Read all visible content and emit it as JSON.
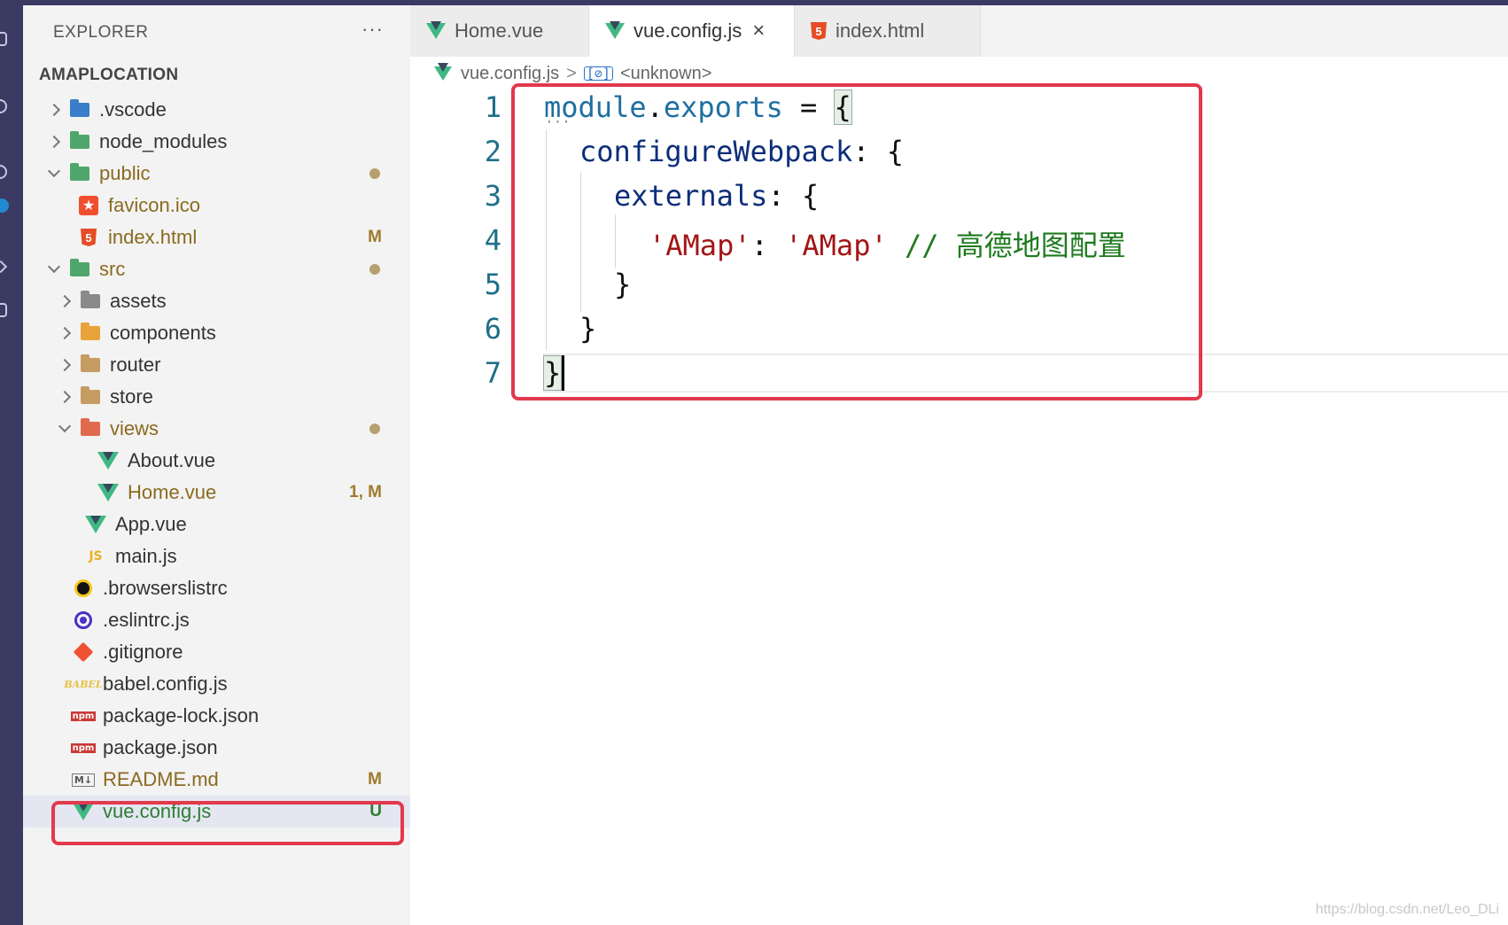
{
  "explorer": {
    "title": "EXPLORER",
    "more": "···",
    "root_label": "AMAPLOCATION",
    "items": [
      {
        "name": ".vscode",
        "icon": "folder-vscode-icon",
        "deco": ""
      },
      {
        "name": "node_modules",
        "icon": "folder-node-icon",
        "deco": ""
      },
      {
        "name": "public",
        "icon": "folder-public-icon",
        "deco": "dot"
      },
      {
        "name": "favicon.ico",
        "icon": "favicon-icon",
        "deco": ""
      },
      {
        "name": "index.html",
        "icon": "html5-icon",
        "deco": "M"
      },
      {
        "name": "src",
        "icon": "folder-src-icon",
        "deco": "dot"
      },
      {
        "name": "assets",
        "icon": "folder-assets-icon",
        "deco": ""
      },
      {
        "name": "components",
        "icon": "folder-components-icon",
        "deco": ""
      },
      {
        "name": "router",
        "icon": "folder-icon",
        "deco": ""
      },
      {
        "name": "store",
        "icon": "folder-icon",
        "deco": ""
      },
      {
        "name": "views",
        "icon": "folder-views-icon",
        "deco": "dot"
      },
      {
        "name": "About.vue",
        "icon": "vue-icon",
        "deco": ""
      },
      {
        "name": "Home.vue",
        "icon": "vue-icon",
        "deco": "1, M"
      },
      {
        "name": "App.vue",
        "icon": "vue-icon",
        "deco": ""
      },
      {
        "name": "main.js",
        "icon": "js-icon",
        "deco": ""
      },
      {
        "name": ".browserslistrc",
        "icon": "browserslist-icon",
        "deco": ""
      },
      {
        "name": ".eslintrc.js",
        "icon": "eslint-icon",
        "deco": ""
      },
      {
        "name": ".gitignore",
        "icon": "git-icon",
        "deco": ""
      },
      {
        "name": "babel.config.js",
        "icon": "babel-icon",
        "deco": ""
      },
      {
        "name": "package-lock.json",
        "icon": "npm-icon",
        "deco": ""
      },
      {
        "name": "package.json",
        "icon": "npm-icon",
        "deco": ""
      },
      {
        "name": "README.md",
        "icon": "markdown-icon",
        "deco": "M"
      },
      {
        "name": "vue.config.js",
        "icon": "vue-config-icon",
        "deco": "U"
      }
    ]
  },
  "icon_text": {
    "html": "5",
    "star": "★",
    "js": "JS",
    "npm": "npm",
    "babel": "BABEL",
    "md": "M↓"
  },
  "tabs": [
    {
      "label": "Home.vue",
      "icon": "vue-icon",
      "active": false
    },
    {
      "label": "vue.config.js",
      "icon": "vue-config-icon",
      "active": true
    },
    {
      "label": "index.html",
      "icon": "html5-icon",
      "active": false
    }
  ],
  "tab_close": "×",
  "breadcrumb": {
    "file": "vue.config.js",
    "separator": ">",
    "symbol_icon": "[⊘]",
    "symbol": "<unknown>"
  },
  "editor": {
    "line_numbers": [
      "1",
      "2",
      "3",
      "4",
      "5",
      "6",
      "7"
    ],
    "code": {
      "l1_a": "module",
      "l1_b": ".",
      "l1_c": "exports",
      "l1_d": " = ",
      "l1_e": "{",
      "l2_a": "configureWebpack",
      "l2_b": ": {",
      "l3_a": "externals",
      "l3_b": ": {",
      "l4_a": "'AMap'",
      "l4_b": ": ",
      "l4_c": "'AMap'",
      "l4_d": " // 高德地图配置",
      "l5": "}",
      "l6": "}",
      "l7": "}"
    },
    "fold_marker": "···"
  },
  "watermark": "https://blog.csdn.net/Leo_DLi",
  "colors": {
    "accent_red": "#e2394d",
    "activity_bar": "#3b3a63",
    "modified": "#a07a2c",
    "untracked": "#2e7d32"
  }
}
